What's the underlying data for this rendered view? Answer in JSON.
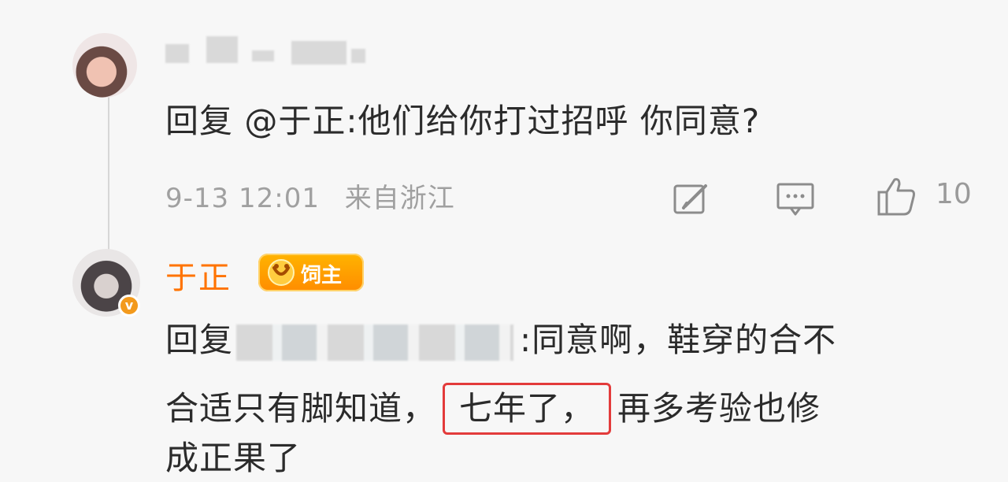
{
  "first_comment": {
    "text": "回复 @于正:他们给你打过招呼 你同意?",
    "meta": {
      "date": "9-13 12:01",
      "location": "来自浙江"
    },
    "likes": "10"
  },
  "reply": {
    "author_name": "于正",
    "badge_label": "饲主",
    "verified_mark": "v",
    "prefix": "回复",
    "text_after_mention": ":同意啊，鞋穿的合不",
    "line2_before": "合适只有脚知道，",
    "highlighted": "七年了，",
    "line2_after": "再多考验也修",
    "line3": "成正果了"
  },
  "colors": {
    "author": "#ff7300",
    "badge": "#ff9f00",
    "highlight_border": "#e33b3b",
    "meta_text": "#a0a0a0"
  },
  "icons": [
    "edit-icon",
    "comment-icon",
    "like-icon",
    "badge-icon"
  ]
}
